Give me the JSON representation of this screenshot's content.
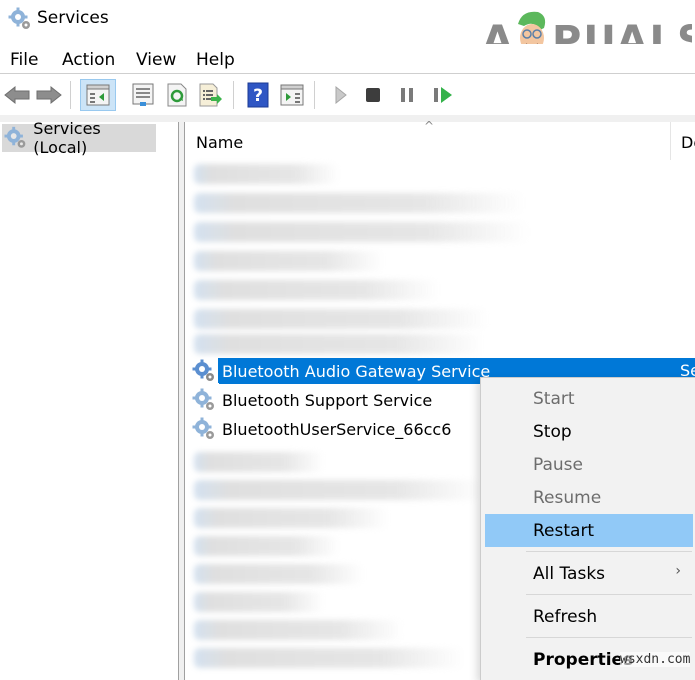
{
  "window": {
    "title": "Services",
    "icon": "services-gear-icon"
  },
  "logo": {
    "text": "A PUALS",
    "left": "A",
    "right": "PUALS"
  },
  "menubar": {
    "items": [
      "File",
      "Action",
      "View",
      "Help"
    ]
  },
  "toolbar": {
    "buttons": [
      {
        "name": "back-arrow-icon"
      },
      {
        "name": "forward-arrow-icon"
      },
      {
        "name": "show-hide-console-tree-icon",
        "active": true
      },
      {
        "name": "properties-sheet-icon"
      },
      {
        "name": "refresh-icon"
      },
      {
        "name": "export-list-icon"
      },
      {
        "name": "help-icon"
      },
      {
        "name": "show-action-pane-icon"
      },
      {
        "name": "start-service-icon"
      },
      {
        "name": "stop-service-icon"
      },
      {
        "name": "pause-service-icon"
      },
      {
        "name": "restart-service-icon"
      }
    ]
  },
  "tree": {
    "root": "Services (Local)"
  },
  "list": {
    "columns": {
      "name": "Name",
      "description": "De",
      "sort_indicator": "^"
    },
    "services": [
      {
        "name": "Bluetooth Audio Gateway Service",
        "selected": true,
        "desc_fragment": "Se"
      },
      {
        "name": "Bluetooth Support Service",
        "selected": false
      },
      {
        "name": "BluetoothUserService_66cc6",
        "selected": false
      }
    ]
  },
  "context_menu": {
    "items": [
      {
        "label": "Start",
        "disabled": true
      },
      {
        "label": "Stop",
        "disabled": false
      },
      {
        "label": "Pause",
        "disabled": true
      },
      {
        "label": "Resume",
        "disabled": true
      },
      {
        "label": "Restart",
        "disabled": false,
        "highlighted": true
      },
      {
        "label": "All Tasks",
        "disabled": false,
        "submenu": true,
        "arrow": "›"
      },
      {
        "label": "Refresh",
        "disabled": false
      },
      {
        "label": "Properties",
        "disabled": false,
        "bold": true
      }
    ]
  },
  "watermark": "wsxdn.com"
}
